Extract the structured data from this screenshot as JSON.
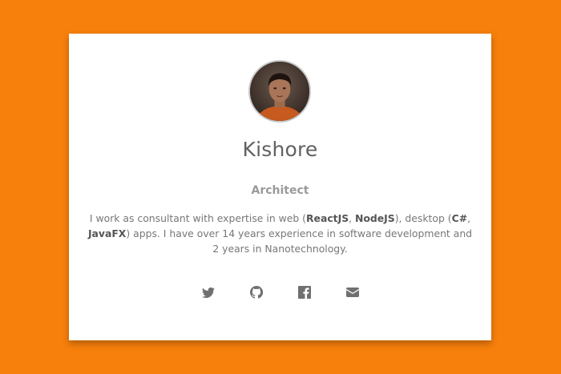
{
  "profile": {
    "name": "Kishore",
    "role": "Architect",
    "bio": [
      {
        "text": "I work as consultant with expertise in web (",
        "bold": false
      },
      {
        "text": "ReactJS",
        "bold": true
      },
      {
        "text": ", ",
        "bold": false
      },
      {
        "text": "NodeJS",
        "bold": true
      },
      {
        "text": "), desktop (",
        "bold": false
      },
      {
        "text": "C#",
        "bold": true
      },
      {
        "text": ", ",
        "bold": false
      },
      {
        "text": "JavaFX",
        "bold": true
      },
      {
        "text": ") apps. I have over 14 years experience in software development and 2 years in Nanotechnology.",
        "bold": false
      }
    ]
  },
  "socials": [
    {
      "name": "twitter-icon",
      "icon": "twitter"
    },
    {
      "name": "github-icon",
      "icon": "github"
    },
    {
      "name": "facebook-icon",
      "icon": "facebook"
    },
    {
      "name": "email-icon",
      "icon": "envelope"
    }
  ],
  "colors": {
    "background": "#f77f0b",
    "card": "#ffffff",
    "name_text": "#616161",
    "role_text": "#9a9a9a",
    "icon": "#707070"
  }
}
